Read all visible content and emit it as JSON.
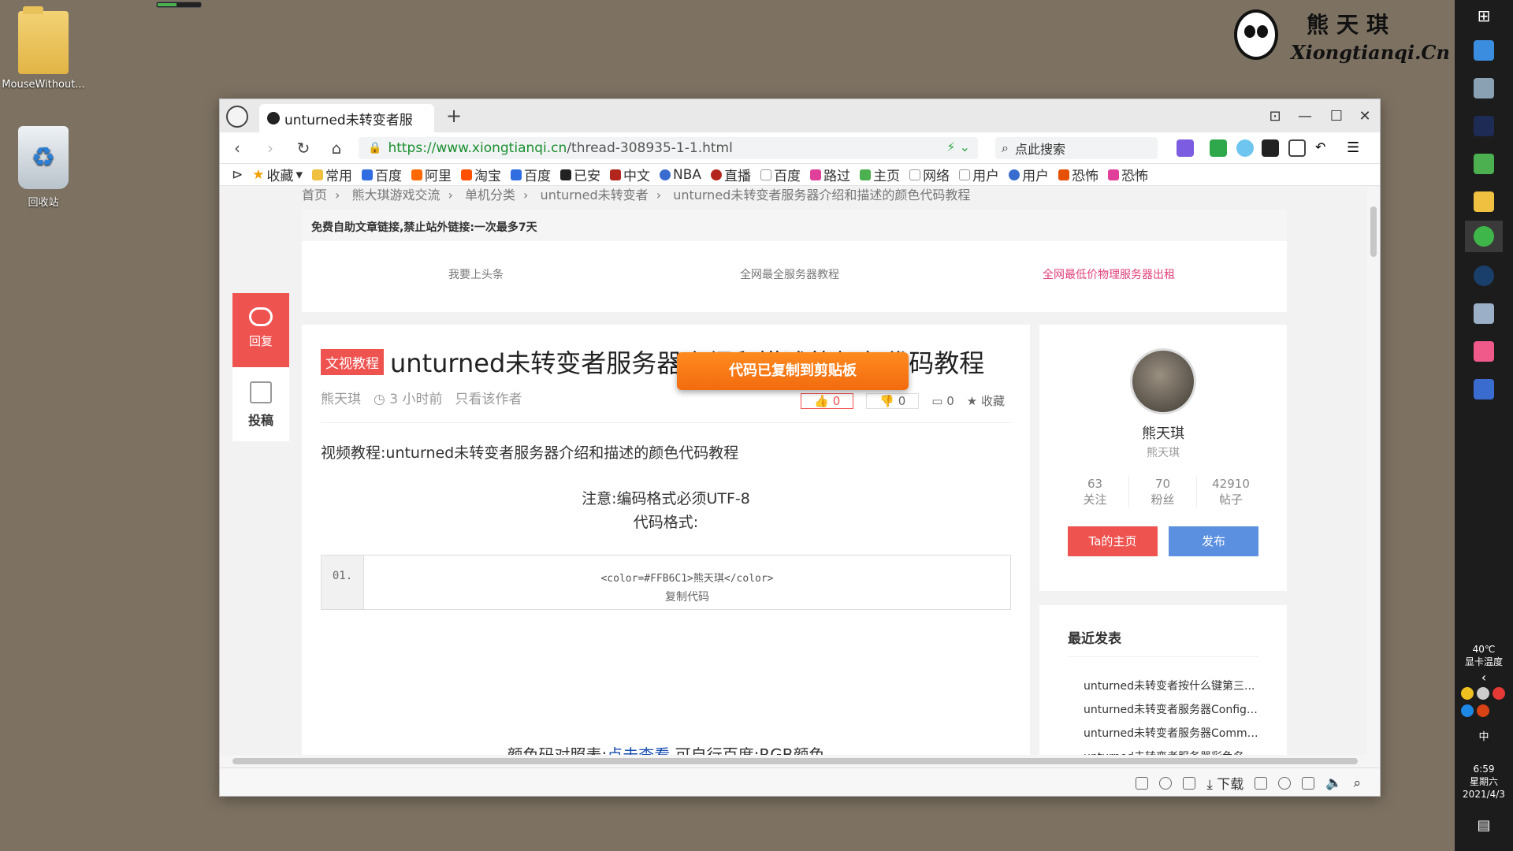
{
  "desktop": {
    "icons": [
      {
        "label": "MouseWithout..."
      },
      {
        "label": "回收站"
      }
    ],
    "brand_cn": "熊天琪",
    "brand_en": "Xiongtianqi.Cn"
  },
  "taskbar": {
    "gpu_temp": "40℃",
    "gpu_label": "显卡温度",
    "ime": "中",
    "time": "6:59",
    "weekday": "星期六",
    "date": "2021/4/3"
  },
  "browser": {
    "tab_title": "unturned未转变者服",
    "url_host": "https://www.xiongtianqi.cn",
    "url_path": "/thread-308935-1-1.html",
    "search_placeholder": "点此搜索",
    "bookmarks": [
      "收藏",
      "常用",
      "百度",
      "阿里",
      "淘宝",
      "百度",
      "已安",
      "中文",
      "NBA",
      "直播",
      "百度",
      "路过",
      "主页",
      "网络",
      "用户",
      "用户",
      "恐怖",
      "恐怖"
    ],
    "status_download": "下载"
  },
  "page": {
    "breadcrumb": [
      "首页",
      "熊大琪游戏交流",
      "单机分类",
      "unturned未转变者",
      "unturned未转变者服务器介绍和描述的颜色代码教程"
    ],
    "notice_title": "免费自助文章链接,禁止站外链接:一次最多7天",
    "notice_links": [
      "我要上头条",
      "全网最全服务器教程",
      "全网最低价物理服务器出租"
    ],
    "side_reply": "回复",
    "side_post": "投稿",
    "article": {
      "tag": "文视教程",
      "title": "unturned未转变者服务器介绍和描述的颜色代码教程",
      "author": "熊天琪",
      "time": "3 小时前",
      "only_author": "只看该作者",
      "like_count": "0",
      "dislike_count": "0",
      "comment_count": "0",
      "favorite": "收藏",
      "intro": "视频教程:unturned未转变者服务器介绍和描述的颜色代码教程",
      "note_line1": "注意:编码格式必须UTF-8",
      "note_line2": "代码格式:",
      "code_line_no": "01.",
      "code": "<color=#FFB6C1>熊天琪</color>",
      "copy_code": "复制代码",
      "bottom_prefix": "颜色码对照表:",
      "bottom_link": "点击查看",
      "bottom_suffix": " 可自行百度:RGB颜色"
    },
    "toast": "代码已复制到剪贴板",
    "profile": {
      "name": "熊天琪",
      "sub": "熊天琪",
      "stats": [
        {
          "value": "63",
          "label": "关注"
        },
        {
          "value": "70",
          "label": "粉丝"
        },
        {
          "value": "42910",
          "label": "帖子"
        }
      ],
      "btn_home": "Ta的主页",
      "btn_publish": "发布"
    },
    "recent": {
      "title": "最近发表",
      "items": [
        "unturned未转变者按什么键第三...",
        "unturned未转变者服务器Config.j...",
        "unturned未转变者服务器Comma...",
        "unturned未转变者服务器彩色名..."
      ]
    }
  }
}
